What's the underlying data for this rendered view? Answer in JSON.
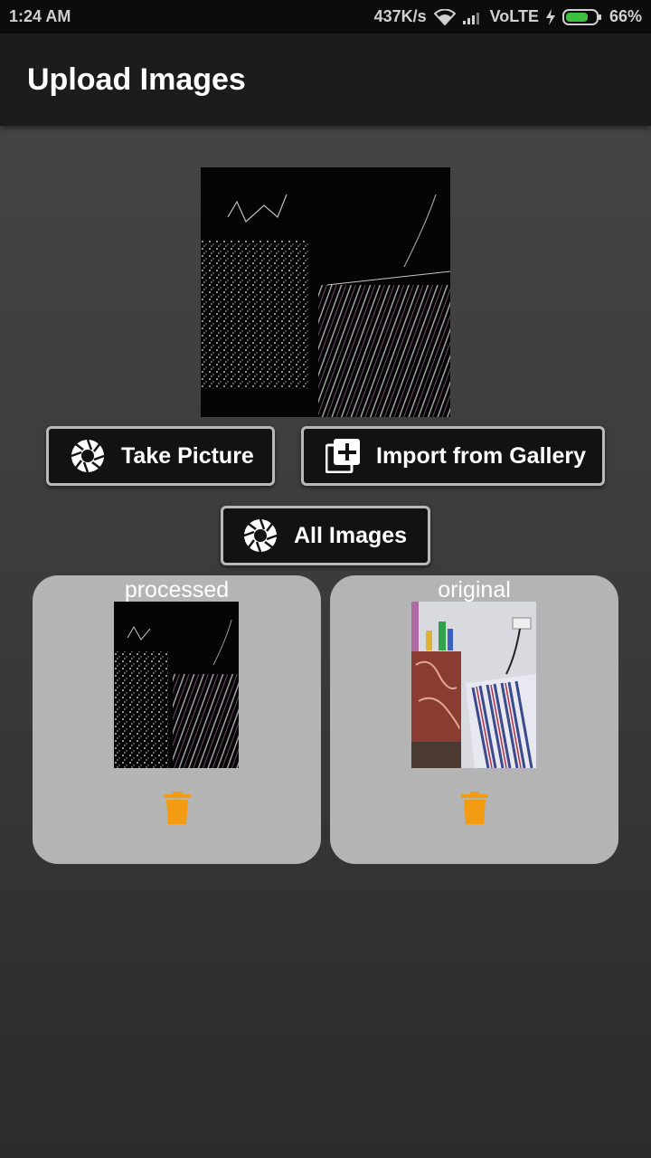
{
  "status_bar": {
    "time": "1:24 AM",
    "network_speed": "437K/s",
    "carrier": "VoLTE",
    "battery": "66%",
    "battery_level": 0.66,
    "icons": [
      "wifi-icon",
      "signal-icon",
      "charging-icon",
      "battery-icon"
    ]
  },
  "app_bar": {
    "title": "Upload Images"
  },
  "buttons": {
    "take_picture": "Take Picture",
    "import_gallery": "Import from Gallery",
    "all_images": "All Images"
  },
  "cards": [
    {
      "label": "processed",
      "action_icon": "delete-icon"
    },
    {
      "label": "original",
      "action_icon": "delete-icon"
    }
  ],
  "colors": {
    "app_bar": "#1c1c1c",
    "card": "#b4b4b4",
    "button_bg": "#121212",
    "button_border": "#b9b9b9",
    "delete": "#f39c12"
  }
}
